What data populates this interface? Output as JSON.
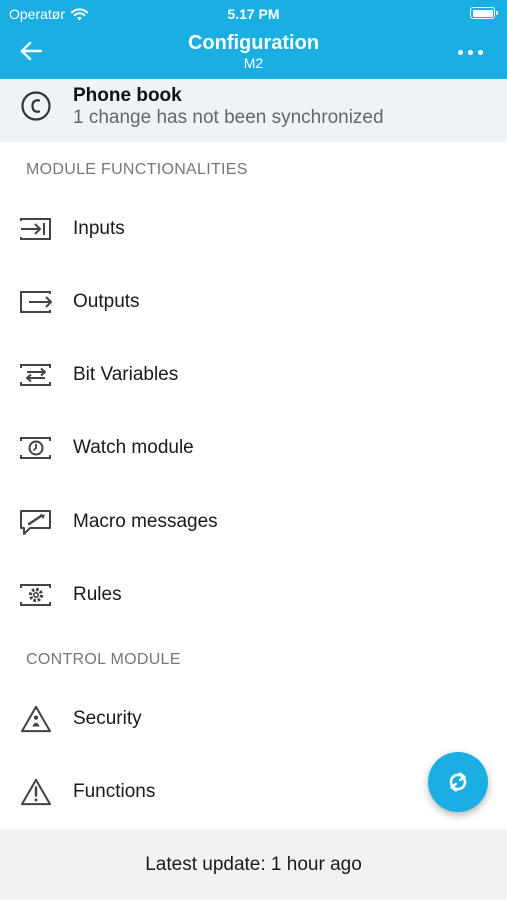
{
  "status_bar": {
    "carrier": "Operatør",
    "time": "5.17 PM"
  },
  "header": {
    "title": "Configuration",
    "subtitle": "M2"
  },
  "banner": {
    "title": "Phone book",
    "subtitle": "1 change has not been synchronized"
  },
  "sections": [
    {
      "title": "MODULE FUNCTIONALITIES",
      "items": [
        {
          "label": "Inputs",
          "icon": "input-icon"
        },
        {
          "label": "Outputs",
          "icon": "output-icon"
        },
        {
          "label": "Bit Variables",
          "icon": "bit-variables-icon"
        },
        {
          "label": "Watch module",
          "icon": "watch-module-icon"
        },
        {
          "label": "Macro messages",
          "icon": "macro-messages-icon"
        },
        {
          "label": "Rules",
          "icon": "rules-gear-icon"
        }
      ]
    },
    {
      "title": "CONTROL MODULE",
      "items": [
        {
          "label": "Security",
          "icon": "security-warning-icon"
        },
        {
          "label": "Functions",
          "icon": "functions-warning-icon"
        }
      ]
    }
  ],
  "footer": {
    "text": "Latest update: 1 hour ago"
  },
  "fab": {
    "icon": "sync-icon"
  },
  "colors": {
    "accent": "#1aaee3",
    "banner_bg": "#eef3f8",
    "footer_bg": "#f2f2f2"
  }
}
